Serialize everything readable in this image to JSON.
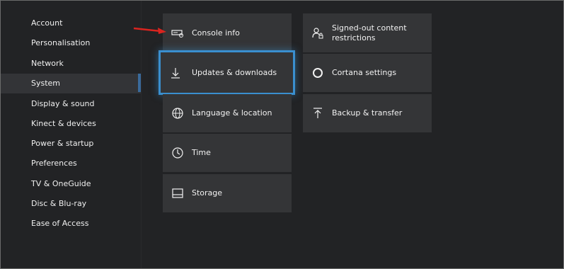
{
  "sidebar": {
    "items": [
      {
        "label": "Account"
      },
      {
        "label": "Personalisation"
      },
      {
        "label": "Network"
      },
      {
        "label": "System"
      },
      {
        "label": "Display & sound"
      },
      {
        "label": "Kinect & devices"
      },
      {
        "label": "Power & startup"
      },
      {
        "label": "Preferences"
      },
      {
        "label": "TV & OneGuide"
      },
      {
        "label": "Disc & Blu-ray"
      },
      {
        "label": "Ease of Access"
      }
    ],
    "selected": "System"
  },
  "tiles": {
    "console_info": {
      "label": "Console info",
      "icon": "console-info-icon"
    },
    "updates_downloads": {
      "label": "Updates & downloads",
      "icon": "download-arrow-icon"
    },
    "language_location": {
      "label": "Language & location",
      "icon": "globe-icon"
    },
    "time": {
      "label": "Time",
      "icon": "clock-icon"
    },
    "storage": {
      "label": "Storage",
      "icon": "storage-icon"
    },
    "signed_out": {
      "label_line1": "Signed-out content",
      "label_line2": "restrictions",
      "icon": "user-lock-icon"
    },
    "cortana": {
      "label": "Cortana settings",
      "icon": "cortana-circle-icon"
    },
    "backup": {
      "label": "Backup & transfer",
      "icon": "upload-arrow-icon"
    }
  },
  "colors": {
    "background": "#222325",
    "tile": "#343537",
    "focus_outline": "#3a8fcf",
    "annotation_arrow": "#d9241f"
  }
}
